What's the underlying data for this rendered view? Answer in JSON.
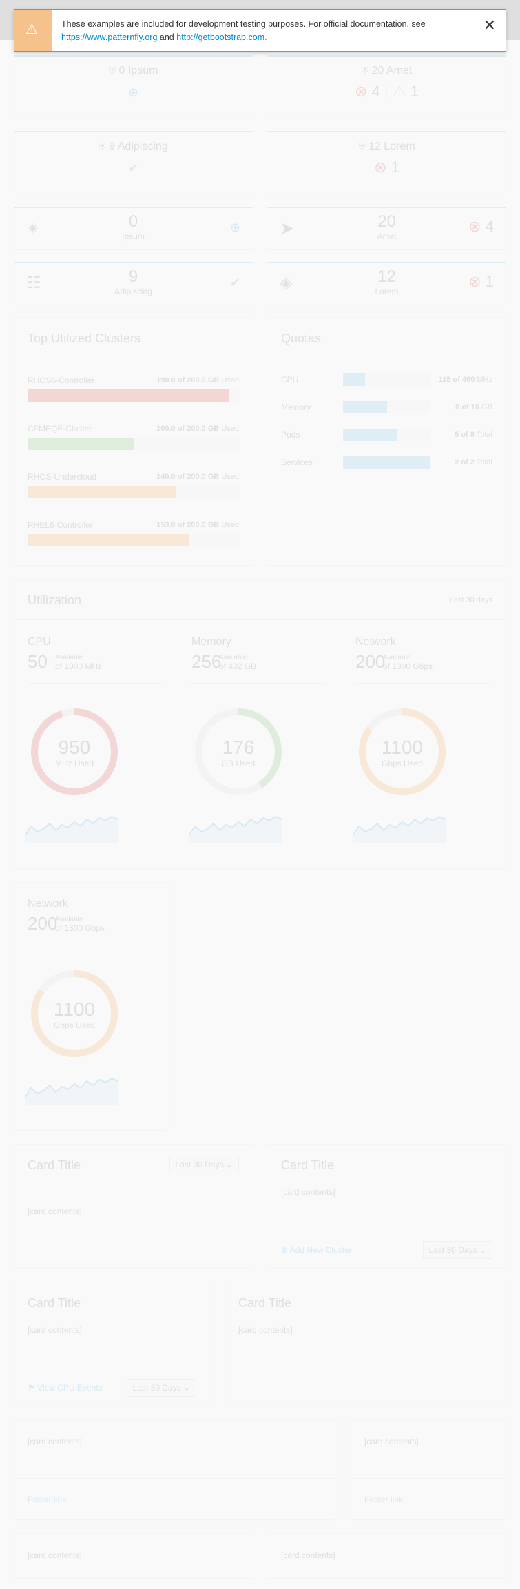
{
  "alert": {
    "text": "These examples are included for development testing purposes. For official documentation, see",
    "link1": "https://www.patternfly.org",
    "and": "and",
    "link2": "http://getbootstrap.com."
  },
  "aggregate_cards": [
    {
      "title": "0 Ipsum",
      "status": ""
    },
    {
      "title": "20 Amet",
      "err_count": "4",
      "warn_count": "1"
    },
    {
      "title": "9 Adipiscing",
      "status": ""
    },
    {
      "title": "12 Lorem",
      "err_count": "1"
    }
  ],
  "mini_cards": [
    {
      "count": "0",
      "label": "Ipsum"
    },
    {
      "count": "20",
      "label": "Amet",
      "err_count": "4"
    },
    {
      "count": "9",
      "label": "Adipiscing"
    },
    {
      "count": "12",
      "label": "Lorem",
      "err_count": "1"
    }
  ],
  "clusters": {
    "title": "Top Utilized Clusters",
    "items": [
      {
        "name": "RHOS6-Controller",
        "used": "190.0 of 200.0 GB",
        "suffix": "Used",
        "pct": 95,
        "color": "#cc0000"
      },
      {
        "name": "CFMEQE-Cluster",
        "used": "100.0 of 200.0 GB",
        "suffix": "Used",
        "pct": 50,
        "color": "#3f9c35"
      },
      {
        "name": "RHOS-Undercloud",
        "used": "140.0 of 200.0 GB",
        "suffix": "Used",
        "pct": 70,
        "color": "#ec7a08"
      },
      {
        "name": "RHEL6-Controller",
        "used": "153.0 of 200.0 GB",
        "suffix": "Used",
        "pct": 76.5,
        "color": "#ec7a08"
      }
    ]
  },
  "quotas": {
    "title": "Quotas",
    "items": [
      {
        "name": "CPU",
        "used": "115 of 460",
        "unit": "MHz",
        "pct": 25
      },
      {
        "name": "Memory",
        "used": "8 of 16",
        "unit": "GB",
        "pct": 50
      },
      {
        "name": "Pods",
        "used": "5 of 8",
        "unit": "Total",
        "pct": 62.5
      },
      {
        "name": "Services",
        "used": "2 of 2",
        "unit": "Total",
        "pct": 100
      }
    ]
  },
  "utilization": {
    "title": "Utilization",
    "range": "Last 30 days",
    "panels": [
      {
        "title": "CPU",
        "available": "50",
        "avail_label": "Available",
        "of_label": "of 1000 MHz",
        "used": "950",
        "used_label": "MHz Used",
        "pct": 95,
        "color": "#cc0000"
      },
      {
        "title": "Memory",
        "available": "256",
        "avail_label": "Available",
        "of_label": "of 432 GB",
        "used": "176",
        "used_label": "GB Used",
        "pct": 40.7,
        "color": "#3f9c35"
      },
      {
        "title": "Network",
        "available": "200",
        "avail_label": "Available",
        "of_label": "of 1300 Gbps",
        "used": "1100",
        "used_label": "Gbps Used",
        "pct": 84.6,
        "color": "#ec7a08"
      }
    ]
  },
  "network_card": {
    "title": "Network",
    "available": "200",
    "avail_label": "Available",
    "of_label": "of 1300 Gbps",
    "used": "1100",
    "used_label": "Gbps Used",
    "pct": 84.6,
    "color": "#ec7a08"
  },
  "cards": {
    "title": "Card Title",
    "contents": "[card contents]",
    "range": "Last 30 Days",
    "add_cluster": "Add New Cluster",
    "view_events": "View CPU Events",
    "footer_link": "Footer link"
  }
}
